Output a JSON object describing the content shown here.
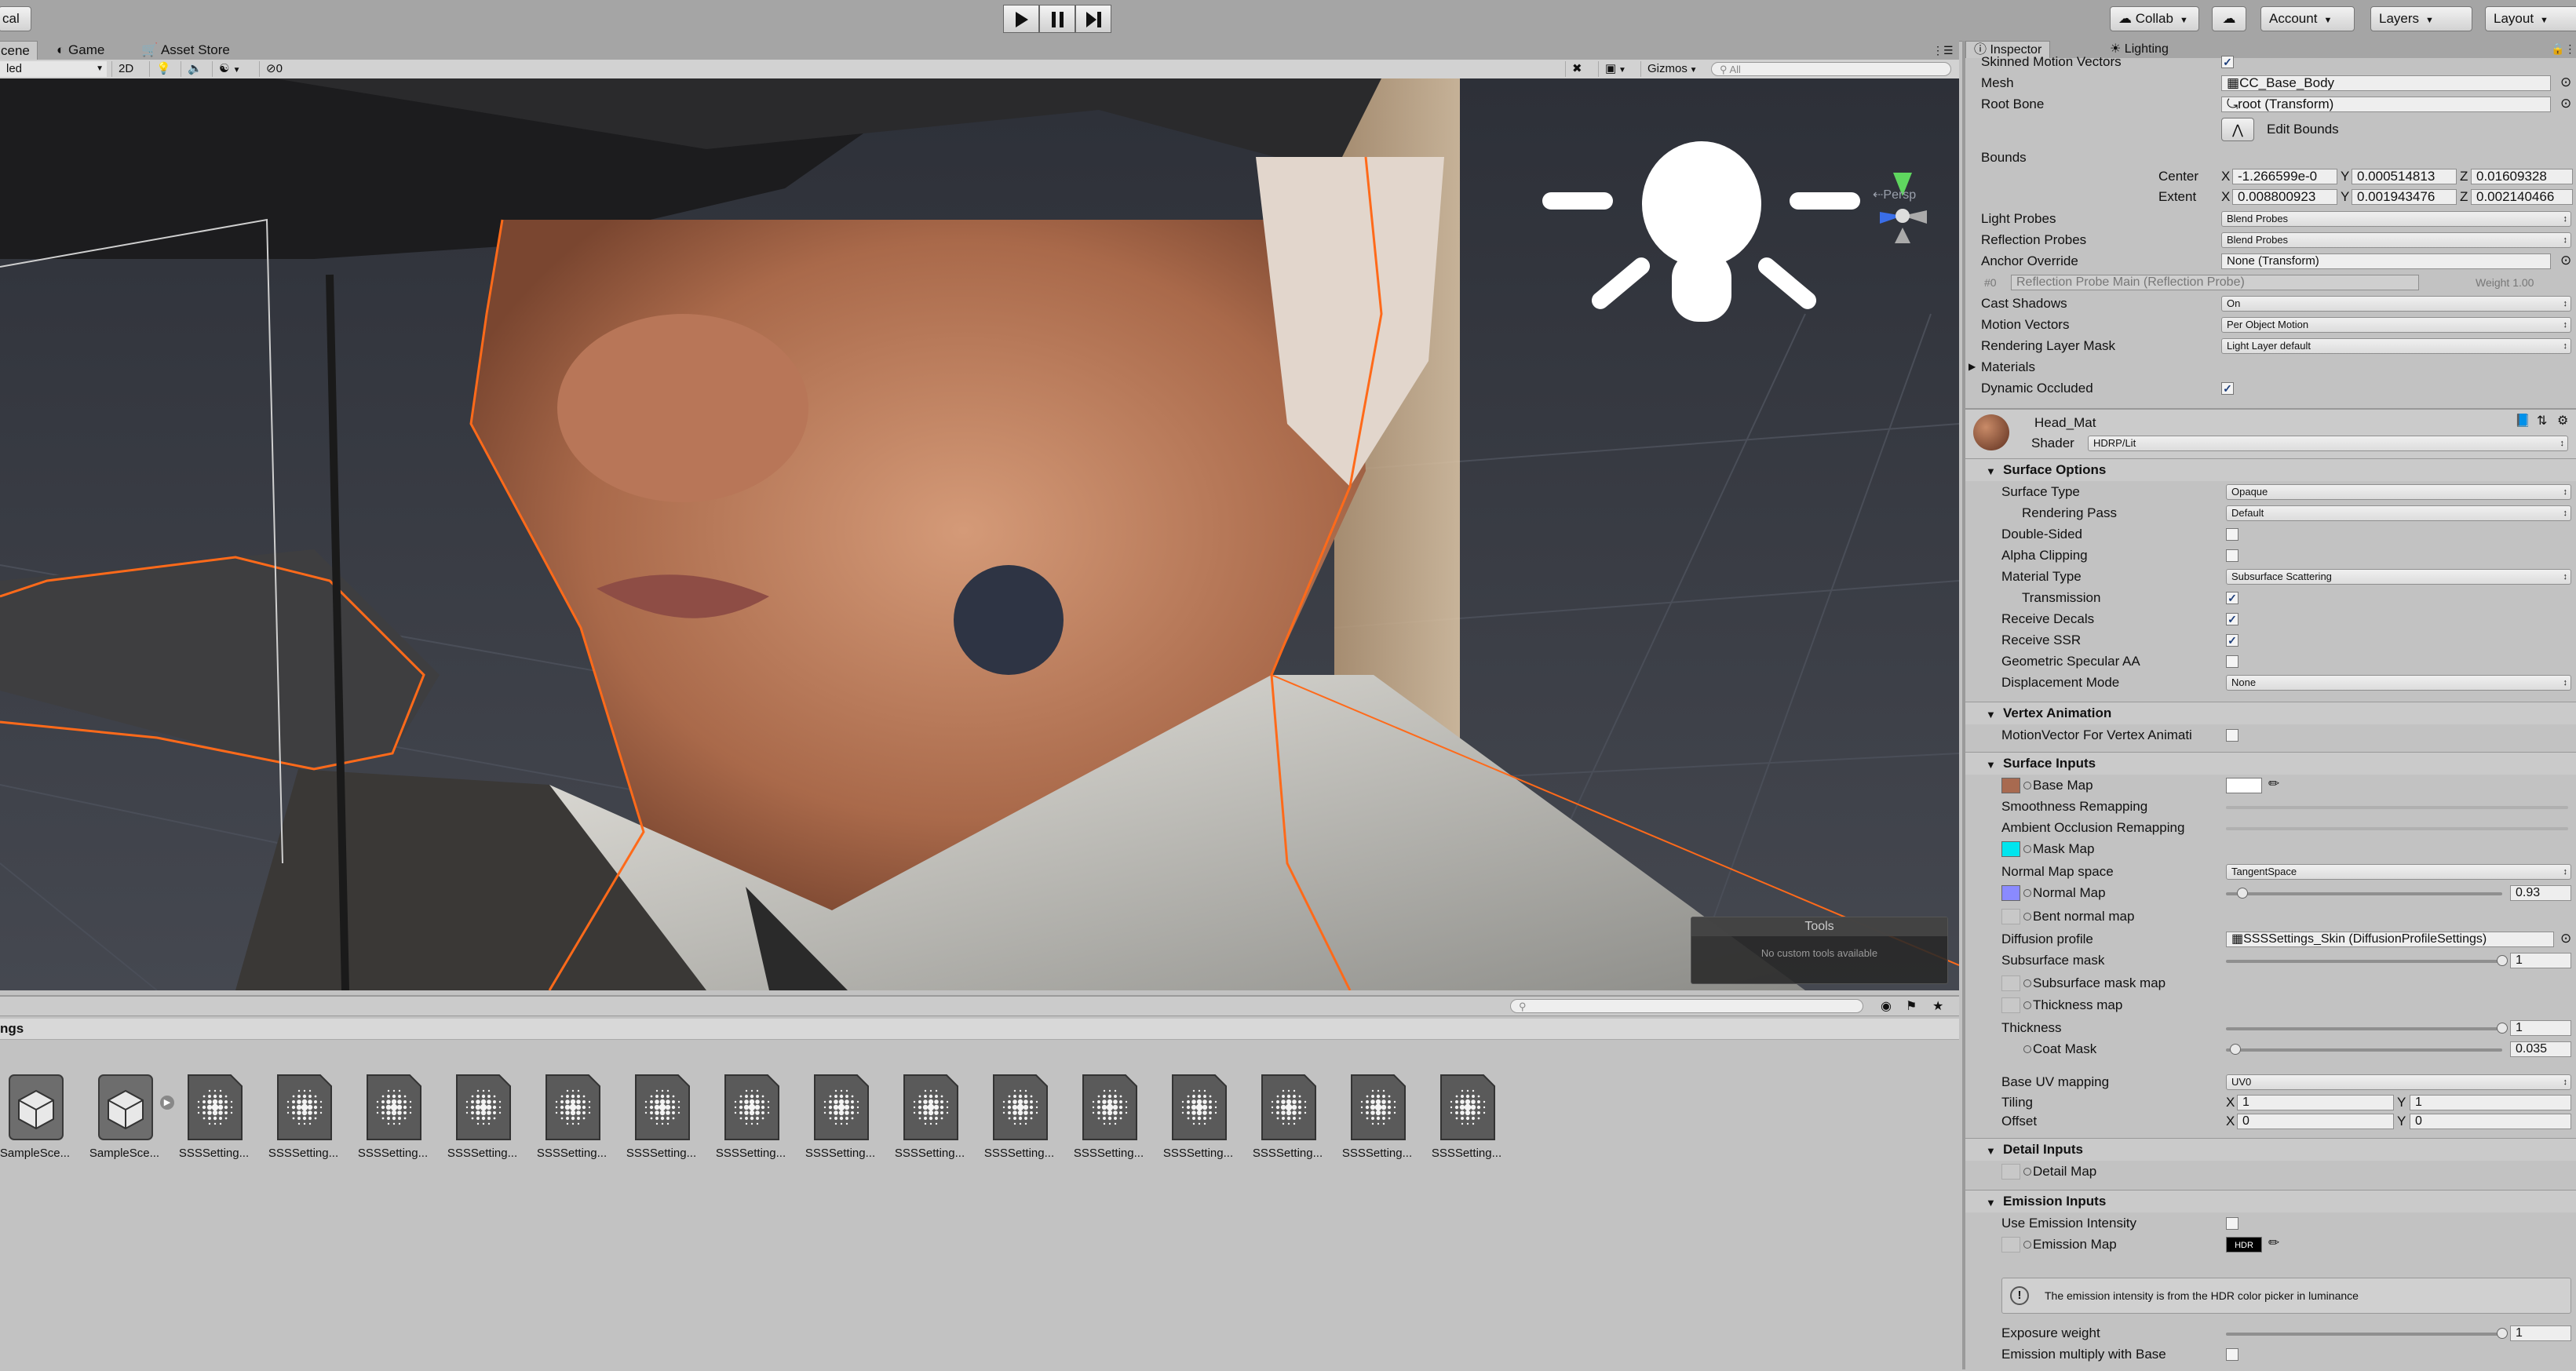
{
  "toolbar": {
    "left_label": "cal",
    "collab": "Collab",
    "account": "Account",
    "layers": "Layers",
    "layout": "Layout"
  },
  "scene_tabs": {
    "scene": "cene",
    "game": "Game",
    "asset_store": "Asset Store",
    "shading": "led",
    "mode_2d": "2D",
    "effects_count": "0",
    "gizmos": "Gizmos",
    "search_placeholder": "All"
  },
  "viewport": {
    "persp_label": "Persp",
    "tools_title": "Tools",
    "tools_message": "No custom tools available"
  },
  "project": {
    "path": "ngs",
    "assets": [
      {
        "name": "SampleSce...",
        "type": "scene-icon"
      },
      {
        "name": "SampleSce...",
        "type": "scene-icon"
      },
      {
        "name": "SSSSetting...",
        "type": "diffusion-profile-icon"
      },
      {
        "name": "SSSSetting...",
        "type": "diffusion-profile-icon"
      },
      {
        "name": "SSSSetting...",
        "type": "diffusion-profile-icon"
      },
      {
        "name": "SSSSetting...",
        "type": "diffusion-profile-icon"
      },
      {
        "name": "SSSSetting...",
        "type": "diffusion-profile-icon"
      },
      {
        "name": "SSSSetting...",
        "type": "diffusion-profile-icon"
      },
      {
        "name": "SSSSetting...",
        "type": "diffusion-profile-icon"
      },
      {
        "name": "SSSSetting...",
        "type": "diffusion-profile-icon"
      },
      {
        "name": "SSSSetting...",
        "type": "diffusion-profile-icon"
      },
      {
        "name": "SSSSetting...",
        "type": "diffusion-profile-icon"
      },
      {
        "name": "SSSSetting...",
        "type": "diffusion-profile-icon"
      },
      {
        "name": "SSSSetting...",
        "type": "diffusion-profile-icon"
      },
      {
        "name": "SSSSetting...",
        "type": "diffusion-profile-icon"
      },
      {
        "name": "SSSSetting...",
        "type": "diffusion-profile-icon"
      },
      {
        "name": "SSSSetting...",
        "type": "diffusion-profile-icon"
      }
    ]
  },
  "inspector": {
    "tab_inspector": "Inspector",
    "tab_lighting": "Lighting",
    "skinned_motion_vectors": "Skinned Motion Vectors",
    "mesh_label": "Mesh",
    "mesh_value": "CC_Base_Body",
    "root_bone_label": "Root Bone",
    "root_bone_value": "root (Transform)",
    "edit_bounds": "Edit Bounds",
    "bounds_label": "Bounds",
    "center_label": "Center",
    "center_x": "-1.266599e-0",
    "center_y": "0.000514813",
    "center_z": "0.01609328",
    "extent_label": "Extent",
    "extent_x": "0.008800923",
    "extent_y": "0.001943476",
    "extent_z": "0.002140466",
    "axis_x": "X",
    "axis_y": "Y",
    "axis_z": "Z",
    "light_probes_label": "Light Probes",
    "light_probes_value": "Blend Probes",
    "reflection_probes_label": "Reflection Probes",
    "reflection_probes_value": "Blend Probes",
    "anchor_override_label": "Anchor Override",
    "anchor_override_value": "None (Transform)",
    "probe_index": "#0",
    "probe_name": "Reflection Probe Main (Reflection Probe)",
    "probe_weight": "Weight 1.00",
    "cast_shadows_label": "Cast Shadows",
    "cast_shadows_value": "On",
    "motion_vectors_label": "Motion Vectors",
    "motion_vectors_value": "Per Object Motion",
    "rendering_layer_mask_label": "Rendering Layer Mask",
    "rendering_layer_mask_value": "Light Layer default",
    "materials_label": "Materials",
    "dynamic_occluded_label": "Dynamic Occluded",
    "material_name": "Head_Mat",
    "shader_label": "Shader",
    "shader_value": "HDRP/Lit",
    "surface_options": "Surface Options",
    "surface_type_label": "Surface Type",
    "surface_type_value": "Opaque",
    "rendering_pass_label": "Rendering Pass",
    "rendering_pass_value": "Default",
    "double_sided_label": "Double-Sided",
    "alpha_clipping_label": "Alpha Clipping",
    "material_type_label": "Material Type",
    "material_type_value": "Subsurface Scattering",
    "transmission_label": "Transmission",
    "receive_decals_label": "Receive Decals",
    "receive_ssr_label": "Receive SSR",
    "geometric_specular_aa_label": "Geometric Specular AA",
    "displacement_mode_label": "Displacement Mode",
    "displacement_mode_value": "None",
    "vertex_animation": "Vertex Animation",
    "motionvector_vertex_label": "MotionVector For Vertex Animati",
    "surface_inputs": "Surface Inputs",
    "base_map_label": "Base Map",
    "smoothness_remapping_label": "Smoothness Remapping",
    "ao_remapping_label": "Ambient Occlusion Remapping",
    "mask_map_label": "Mask Map",
    "normal_map_space_label": "Normal Map space",
    "normal_map_space_value": "TangentSpace",
    "normal_map_label": "Normal Map",
    "normal_map_value": "0.93",
    "normal_map_fraction": 0.06,
    "bent_normal_map_label": "Bent normal map",
    "diffusion_profile_label": "Diffusion profile",
    "diffusion_profile_value": "SSSSettings_Skin (DiffusionProfileSettings)",
    "subsurface_mask_label": "Subsurface mask",
    "subsurface_mask_value": "1",
    "subsurface_mask_fraction": 1.0,
    "subsurface_mask_map_label": "Subsurface mask map",
    "thickness_map_label": "Thickness map",
    "thickness_label": "Thickness",
    "thickness_value": "1",
    "thickness_fraction": 1.0,
    "coat_mask_label": "Coat Mask",
    "coat_mask_value": "0.035",
    "coat_mask_fraction": 0.035,
    "base_uv_mapping_label": "Base UV mapping",
    "base_uv_mapping_value": "UV0",
    "tiling_label": "Tiling",
    "tiling_x": "1",
    "tiling_y": "1",
    "offset_label": "Offset",
    "offset_x": "0",
    "offset_y": "0",
    "detail_inputs": "Detail Inputs",
    "detail_map_label": "Detail Map",
    "emission_inputs": "Emission Inputs",
    "use_emission_intensity_label": "Use Emission Intensity",
    "emission_map_label": "Emission Map",
    "hdr_badge": "HDR",
    "emission_info": "The emission intensity is from the HDR color picker in luminance",
    "exposure_weight_label": "Exposure weight",
    "exposure_weight_value": "1",
    "exposure_weight_fraction": 1.0,
    "emission_multiply_label": "Emission multiply with Base",
    "colors": {
      "accent": "#1c3d7a",
      "mask_map": "#00e5ee",
      "normal_map": "#8a8aff",
      "base_map": "#a86a50",
      "selection_outline": "#ff6a1a"
    }
  }
}
